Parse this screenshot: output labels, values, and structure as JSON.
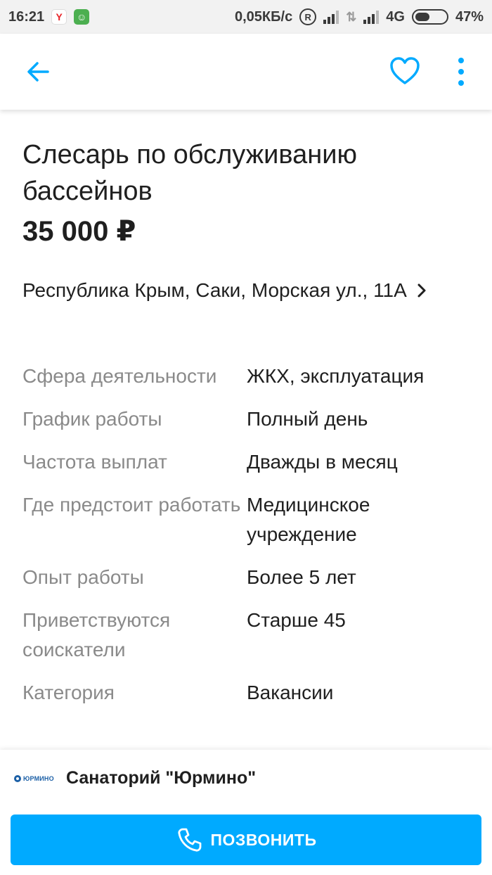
{
  "status_bar": {
    "time": "16:21",
    "yandex_icon_letter": "Y",
    "network_speed": "0,05КБ/с",
    "roaming_badge": "R",
    "network_type": "4G",
    "battery": "47%",
    "battery_level": 0.47
  },
  "appbar": {
    "back_icon": "arrow-left-icon",
    "favorite_icon": "heart-outline-icon",
    "more_icon": "more-vertical-icon",
    "accent_color": "#00aaff"
  },
  "listing": {
    "title": "Слесарь по обслуживанию бассейнов",
    "price": "35 000 ₽",
    "address": "Республика Крым, Саки, Морская ул., 11А",
    "params": [
      {
        "label": "Сфера деятельности",
        "value": "ЖКХ, эксплуатация"
      },
      {
        "label": "График работы",
        "value": "Полный день"
      },
      {
        "label": "Частота выплат",
        "value": "Дважды в месяц"
      },
      {
        "label": "Где предстоит работать",
        "value": "Медицинское учреждение"
      },
      {
        "label": "Опыт работы",
        "value": "Более 5 лет"
      },
      {
        "label": "Приветствуются соискатели",
        "value": "Старше 45"
      },
      {
        "label": "Категория",
        "value": "Вакансии"
      }
    ]
  },
  "company": {
    "logo_text": "ЮРМИНО",
    "name": "Санаторий \"Юрмино\""
  },
  "call_button": {
    "label": "ПОЗВОНИТЬ",
    "icon": "phone-icon",
    "color": "#00aaff"
  }
}
